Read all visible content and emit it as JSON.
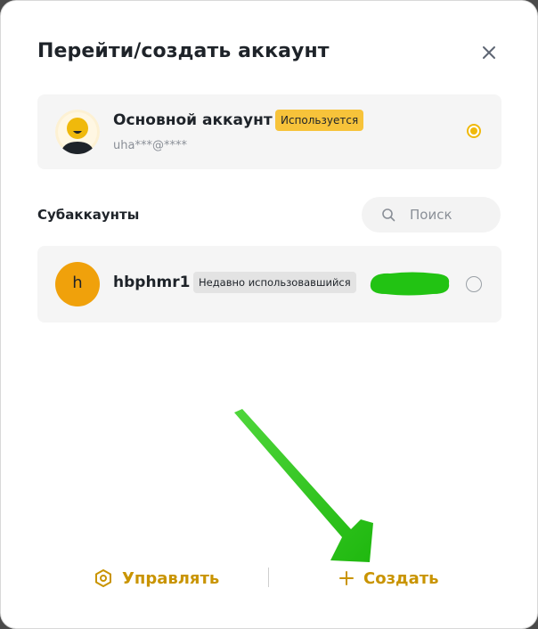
{
  "dialog": {
    "title": "Перейти/создать аккаунт"
  },
  "main_account": {
    "name": "Основной аккаунт",
    "badge": "Используется",
    "email": "uha***@****",
    "selected": true
  },
  "subaccounts": {
    "heading": "Субаккаунты",
    "search_placeholder": "Поиск",
    "items": [
      {
        "avatar_letter": "h",
        "name": "hbphmr1",
        "badge": "Недавно использовавшийся",
        "selected": false
      }
    ]
  },
  "footer": {
    "manage_label": "Управлять",
    "create_label": "Создать"
  },
  "colors": {
    "accent": "#c99400",
    "badge_active": "#f7c33a",
    "avatar_sub": "#f0a10b",
    "annotation_green": "#22c313"
  },
  "icons": [
    "close-icon",
    "search-icon",
    "settings-hex-icon",
    "plus-icon",
    "radio-selected",
    "radio-empty"
  ]
}
